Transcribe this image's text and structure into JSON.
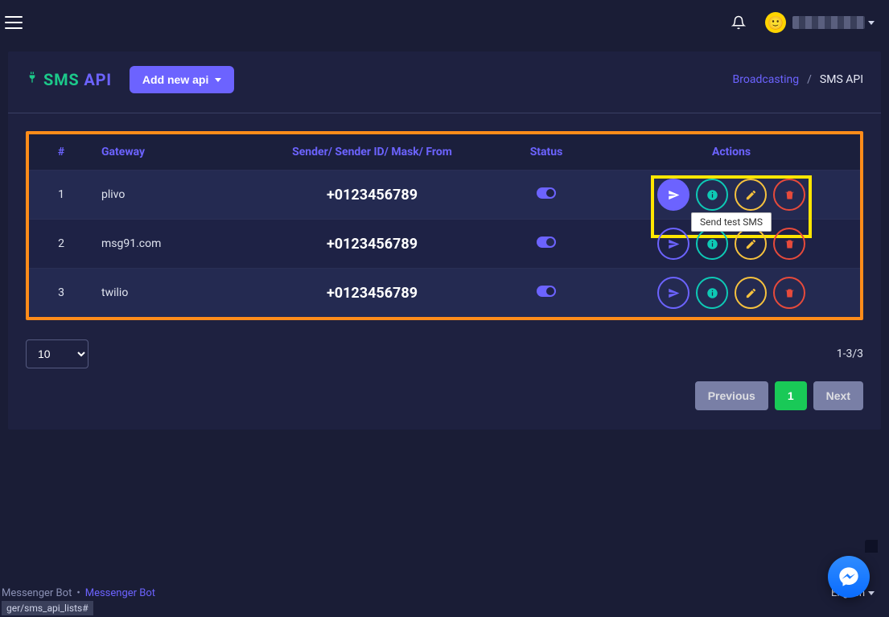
{
  "header": {
    "title_green": "SMS",
    "title_purple": "API",
    "add_button": "Add new api"
  },
  "breadcrumb": {
    "parent": "Broadcasting",
    "sep": "/",
    "current": "SMS API"
  },
  "table": {
    "columns": {
      "idx": "#",
      "gateway": "Gateway",
      "sender": "Sender/ Sender ID/ Mask/ From",
      "status": "Status",
      "actions": "Actions"
    },
    "rows": [
      {
        "idx": "1",
        "gateway": "plivo",
        "sender": "+0123456789"
      },
      {
        "idx": "2",
        "gateway": "msg91.com",
        "sender": "+0123456789"
      },
      {
        "idx": "3",
        "gateway": "twilio",
        "sender": "+0123456789"
      }
    ],
    "tooltip": "Send test SMS"
  },
  "pagination": {
    "page_size": "10",
    "range": "1-3/3",
    "prev": "Previous",
    "page": "1",
    "next": "Next"
  },
  "footer": {
    "left1": "Messenger Bot",
    "dot": "•",
    "link": "Messenger Bot",
    "lang": "English",
    "url": "ger/sms_api_lists#"
  }
}
